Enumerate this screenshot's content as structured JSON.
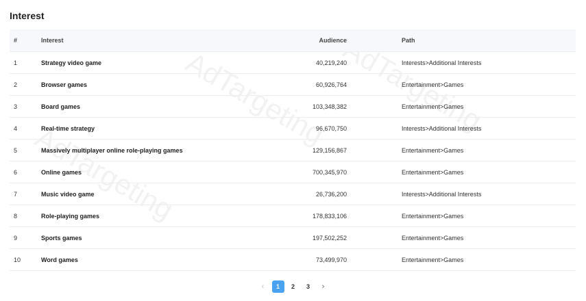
{
  "title": "Interest",
  "columns": {
    "index": "#",
    "interest": "Interest",
    "audience": "Audience",
    "path": "Path"
  },
  "rows": [
    {
      "index": "1",
      "interest": "Strategy video game",
      "audience": "40,219,240",
      "path": "Interests>Additional Interests"
    },
    {
      "index": "2",
      "interest": "Browser games",
      "audience": "60,926,764",
      "path": "Entertainment>Games"
    },
    {
      "index": "3",
      "interest": "Board games",
      "audience": "103,348,382",
      "path": "Entertainment>Games"
    },
    {
      "index": "4",
      "interest": "Real-time strategy",
      "audience": "96,670,750",
      "path": "Interests>Additional Interests"
    },
    {
      "index": "5",
      "interest": "Massively multiplayer online role-playing games",
      "audience": "129,156,867",
      "path": "Entertainment>Games"
    },
    {
      "index": "6",
      "interest": "Online games",
      "audience": "700,345,970",
      "path": "Entertainment>Games"
    },
    {
      "index": "7",
      "interest": "Music video game",
      "audience": "26,736,200",
      "path": "Interests>Additional Interests"
    },
    {
      "index": "8",
      "interest": "Role-playing games",
      "audience": "178,833,106",
      "path": "Entertainment>Games"
    },
    {
      "index": "9",
      "interest": "Sports games",
      "audience": "197,502,252",
      "path": "Entertainment>Games"
    },
    {
      "index": "10",
      "interest": "Word games",
      "audience": "73,499,970",
      "path": "Entertainment>Games"
    }
  ],
  "pagination": {
    "prev_icon": "‹",
    "next_icon": "›",
    "pages": [
      "1",
      "2",
      "3"
    ],
    "current": "1"
  },
  "watermark": "AdTargeting",
  "colors": {
    "accent": "#4aa3f0",
    "header_bg": "#f7f8fb"
  }
}
